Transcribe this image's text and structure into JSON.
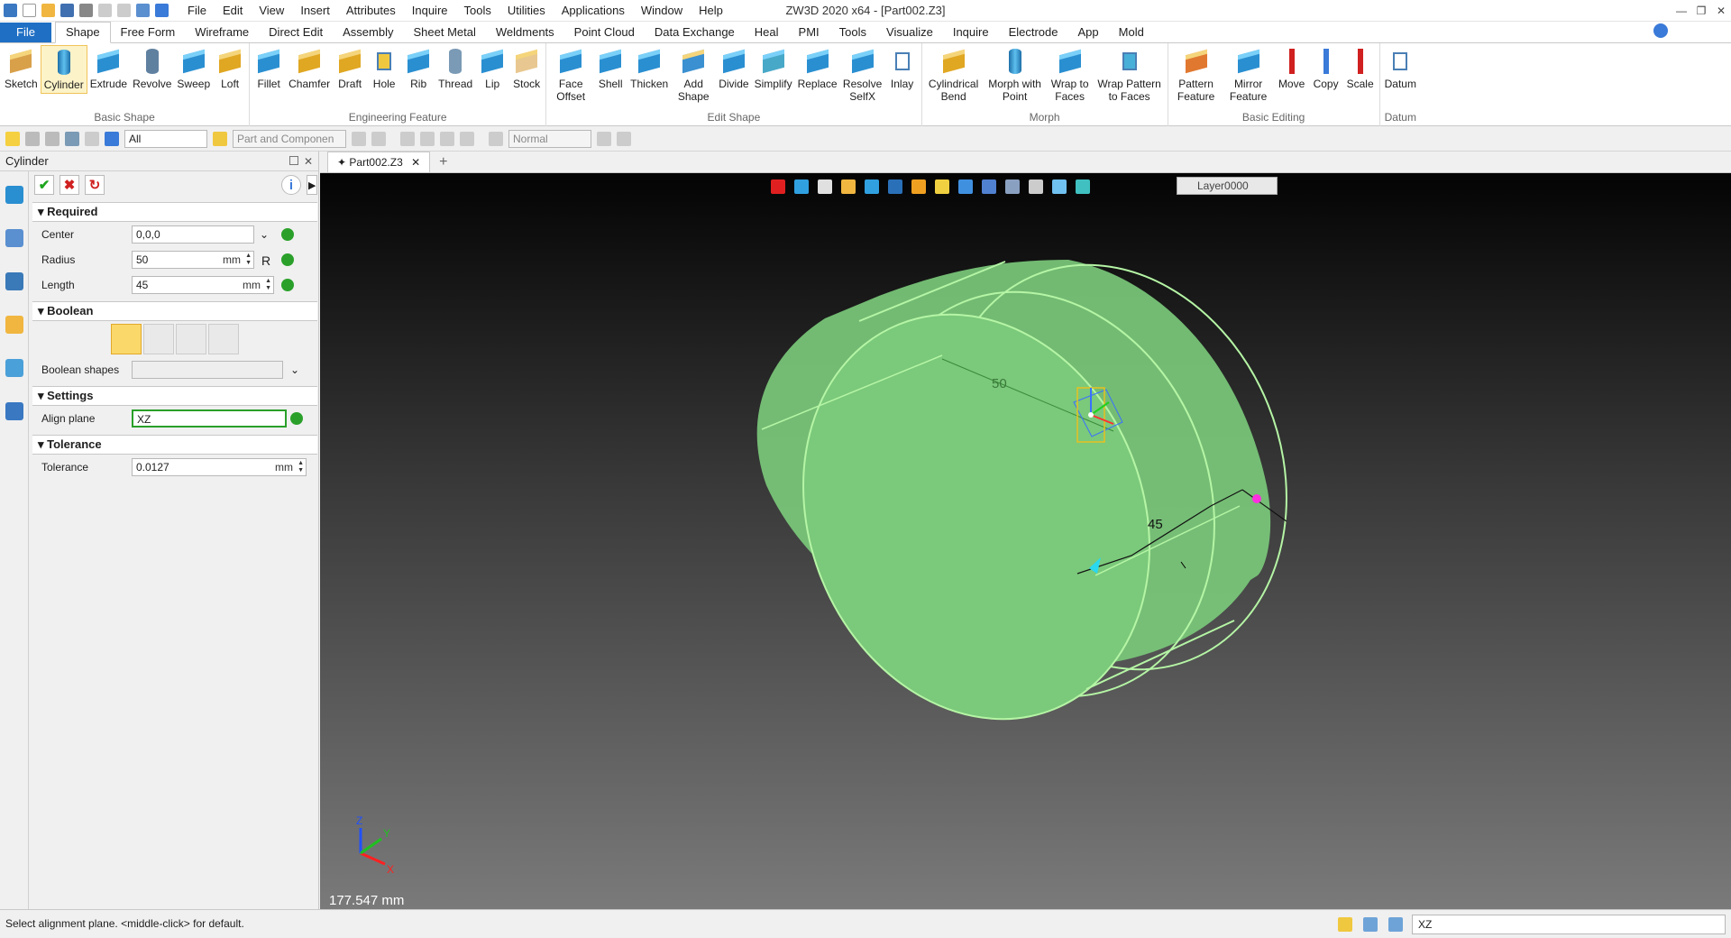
{
  "window": {
    "title": "ZW3D 2020 x64 - [Part002.Z3]"
  },
  "menu": [
    "File",
    "Edit",
    "View",
    "Insert",
    "Attributes",
    "Inquire",
    "Tools",
    "Utilities",
    "Applications",
    "Window",
    "Help"
  ],
  "ribbon_tabs": [
    "File",
    "Shape",
    "Free Form",
    "Wireframe",
    "Direct Edit",
    "Assembly",
    "Sheet Metal",
    "Weldments",
    "Point Cloud",
    "Data Exchange",
    "Heal",
    "PMI",
    "Tools",
    "Visualize",
    "Inquire",
    "Electrode",
    "App",
    "Mold"
  ],
  "ribbon": {
    "basic_shape": {
      "label": "Basic Shape",
      "buttons": [
        "Sketch",
        "Cylinder",
        "Extrude",
        "Revolve",
        "Sweep",
        "Loft"
      ]
    },
    "engineering": {
      "label": "Engineering Feature",
      "buttons": [
        "Fillet",
        "Chamfer",
        "Draft",
        "Hole",
        "Rib",
        "Thread",
        "Lip",
        "Stock"
      ]
    },
    "edit_shape": {
      "label": "Edit Shape",
      "buttons": [
        "Face Offset",
        "Shell",
        "Thicken",
        "Add Shape",
        "Divide",
        "Simplify",
        "Replace",
        "Resolve SelfX",
        "Inlay"
      ]
    },
    "morph": {
      "label": "Morph",
      "buttons": [
        "Cylindrical Bend",
        "Morph with Point",
        "Wrap to Faces",
        "Wrap Pattern to Faces"
      ]
    },
    "basic_editing": {
      "label": "Basic Editing",
      "buttons": [
        "Pattern Feature",
        "Mirror Feature",
        "Move",
        "Copy",
        "Scale"
      ]
    },
    "datum": {
      "label": "Datum",
      "buttons": [
        "Datum"
      ]
    }
  },
  "filter": {
    "all": "All",
    "part": "Part and Componen",
    "mode": "Normal"
  },
  "panel": {
    "title": "Cylinder",
    "required": {
      "label": "Required",
      "center_label": "Center",
      "center_value": "0,0,0",
      "radius_label": "Radius",
      "radius_value": "50",
      "radius_unit": "mm",
      "radius_suffix": "R",
      "length_label": "Length",
      "length_value": "45",
      "length_unit": "mm"
    },
    "boolean": {
      "label": "Boolean",
      "shapes_label": "Boolean shapes"
    },
    "settings": {
      "label": "Settings",
      "align_label": "Align plane",
      "align_value": "XZ"
    },
    "tolerance": {
      "label": "Tolerance",
      "tol_label": "Tolerance",
      "tol_value": "0.0127",
      "tol_unit": "mm"
    }
  },
  "document": {
    "tab": "Part002.Z3",
    "layer": "Layer0000"
  },
  "viewport": {
    "radius_dim": "50",
    "length_dim": "45",
    "scale": "177.547 mm",
    "axis_z": "Z",
    "axis_x": "X",
    "axis_y": "Y"
  },
  "status": {
    "prompt": "Select alignment plane.  <middle-click> for default.",
    "command": "XZ"
  },
  "colors": {
    "shape_fill": "#7bc97b",
    "shape_edge": "#b5f5a5",
    "accent": "#1f6fc4"
  }
}
